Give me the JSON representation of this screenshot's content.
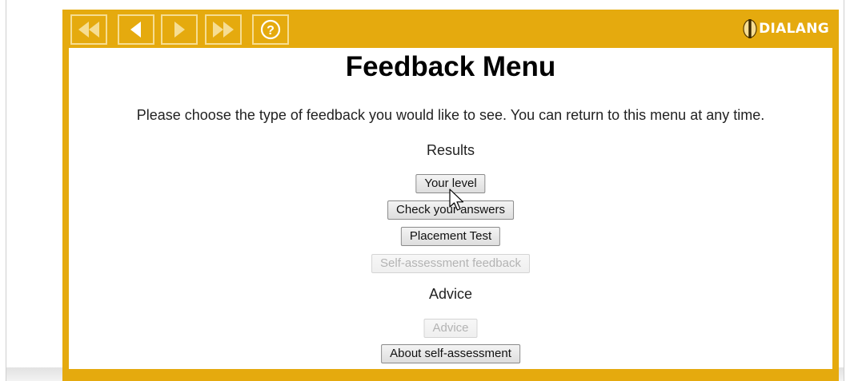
{
  "toolbar": {
    "buttons": [
      {
        "name": "first-page-button",
        "icon": "double-left-arrow-icon"
      },
      {
        "name": "previous-page-button",
        "icon": "left-arrow-icon"
      },
      {
        "name": "next-page-button",
        "icon": "right-arrow-icon"
      },
      {
        "name": "last-page-button",
        "icon": "double-right-arrow-icon"
      },
      {
        "name": "help-button",
        "icon": "help-icon"
      }
    ],
    "logo_text": "DIALANG"
  },
  "colors": {
    "frame": "#e5aa0e",
    "button_border": "#f6dd92",
    "content_background": "#ffffff"
  },
  "page": {
    "title": "Feedback Menu",
    "intro": "Please choose the type of feedback you would like to see. You can return to this menu at any time."
  },
  "results": {
    "heading": "Results",
    "buttons": [
      {
        "label": "Your level",
        "enabled": true
      },
      {
        "label": "Check your answers",
        "enabled": true
      },
      {
        "label": "Placement Test",
        "enabled": true
      },
      {
        "label": "Self-assessment feedback",
        "enabled": false
      }
    ]
  },
  "advice": {
    "heading": "Advice",
    "buttons": [
      {
        "label": "Advice",
        "enabled": false
      },
      {
        "label": "About self-assessment",
        "enabled": true
      }
    ]
  }
}
